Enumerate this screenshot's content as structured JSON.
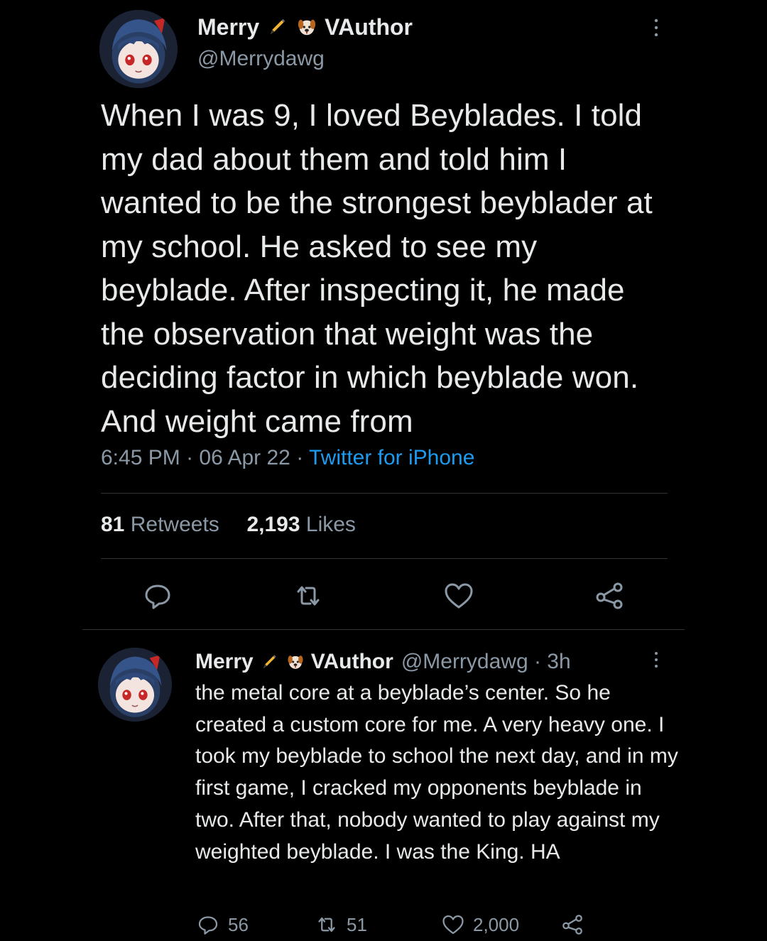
{
  "main_tweet": {
    "display_name": "Merry",
    "badge_suffix": "VAuthor",
    "handle": "@Merrydawg",
    "text": "When I was 9, I loved Beyblades. I told my dad about them and told him I wanted to be the strongest beyblader at my school. He asked to see my beyblade. After inspecting it, he made the observation that weight was the deciding factor in which beyblade won. And weight came from",
    "time": "6:45 PM",
    "date": "06 Apr 22",
    "source": "Twitter for iPhone",
    "retweets_count": "81",
    "retweets_label": "Retweets",
    "likes_count": "2,193",
    "likes_label": "Likes"
  },
  "reply_tweet": {
    "display_name": "Merry",
    "badge_suffix": "VAuthor",
    "handle_time": "@Merrydawg · 3h",
    "text": "the metal core at a beyblade’s center. So he created a custom core for me. A very heavy one. I took my beyblade to school the next day, and in my first game, I cracked my opponents beyblade in two. After that, nobody wanted to play against my weighted beyblade. I was the King. HA",
    "replies": "56",
    "retweets": "51",
    "likes": "2,000"
  },
  "icons": [
    "pen-icon",
    "dog-face-icon",
    "more-icon",
    "reply-icon",
    "retweet-icon",
    "like-icon",
    "share-icon"
  ],
  "colors": {
    "background": "#000000",
    "text": "#e7e9ea",
    "muted": "#8b98a5",
    "link": "#1d9bf0",
    "divider": "#2f3336"
  }
}
